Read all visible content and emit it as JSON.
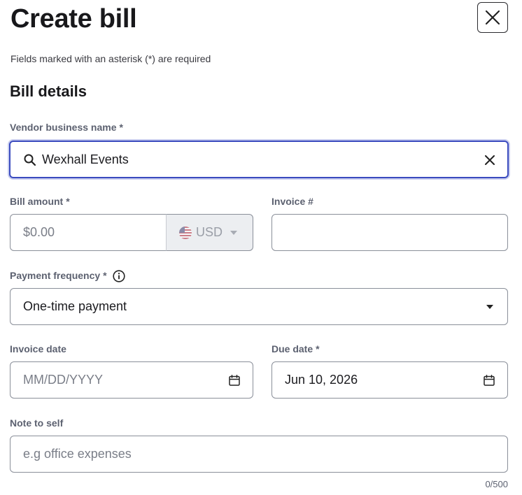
{
  "header": {
    "title": "Create bill",
    "required_note": "Fields marked with an asterisk (*) are required"
  },
  "section": {
    "title": "Bill details"
  },
  "vendor": {
    "label": "Vendor business name",
    "star": "*",
    "value": "Wexhall Events"
  },
  "amount": {
    "label": "Bill amount",
    "star": "*",
    "placeholder": "$0.00",
    "currency": "USD"
  },
  "invoice_number": {
    "label": "Invoice #",
    "value": ""
  },
  "frequency": {
    "label": "Payment frequency",
    "star": "*",
    "value": "One-time payment"
  },
  "invoice_date": {
    "label": "Invoice date",
    "placeholder": "MM/DD/YYYY"
  },
  "due_date": {
    "label": "Due date",
    "star": "*",
    "value": "Jun 10, 2026"
  },
  "note": {
    "label": "Note to self",
    "placeholder": "e.g office expenses",
    "counter": "0/500"
  },
  "icons": {
    "close": "close-icon",
    "search": "search-icon",
    "clear": "clear-icon",
    "info": "info-icon",
    "calendar": "calendar-icon",
    "dropdown": "caret-down-icon",
    "flag": "us-flag-icon"
  },
  "colors": {
    "focus_border": "#3b4bbf",
    "label": "#5c6170",
    "border": "#8a8f99"
  }
}
